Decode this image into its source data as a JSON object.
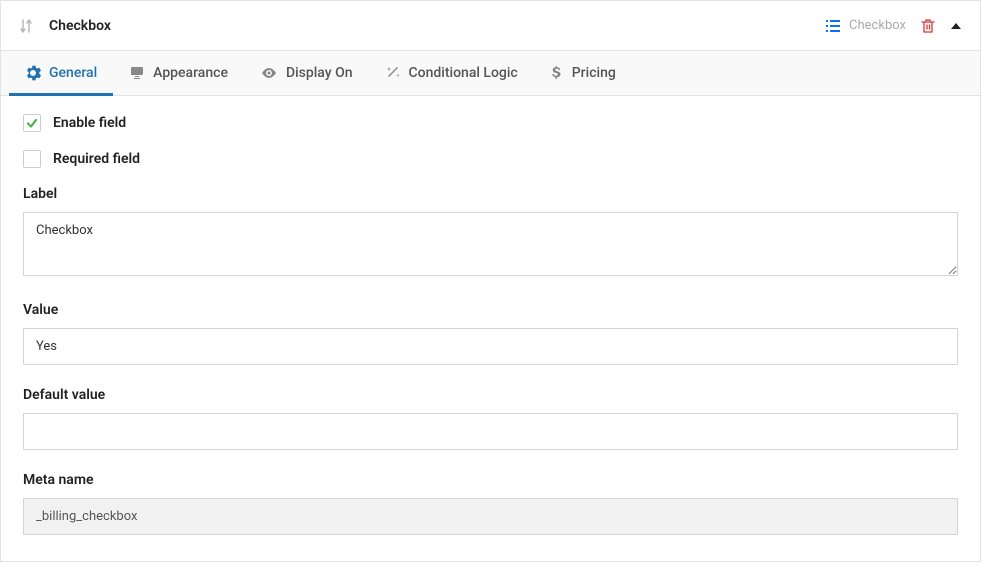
{
  "header": {
    "title": "Checkbox",
    "typeLabel": "Checkbox"
  },
  "tabs": {
    "general": "General",
    "appearance": "Appearance",
    "displayOn": "Display On",
    "conditionalLogic": "Conditional Logic",
    "pricing": "Pricing"
  },
  "fields": {
    "enableLabel": "Enable field",
    "requiredLabel": "Required field",
    "labelLabel": "Label",
    "labelValue": "Checkbox",
    "valueLabel": "Value",
    "valueValue": "Yes",
    "defaultValueLabel": "Default value",
    "defaultValueValue": "",
    "metaNameLabel": "Meta name",
    "metaNameValue": "_billing_checkbox"
  }
}
